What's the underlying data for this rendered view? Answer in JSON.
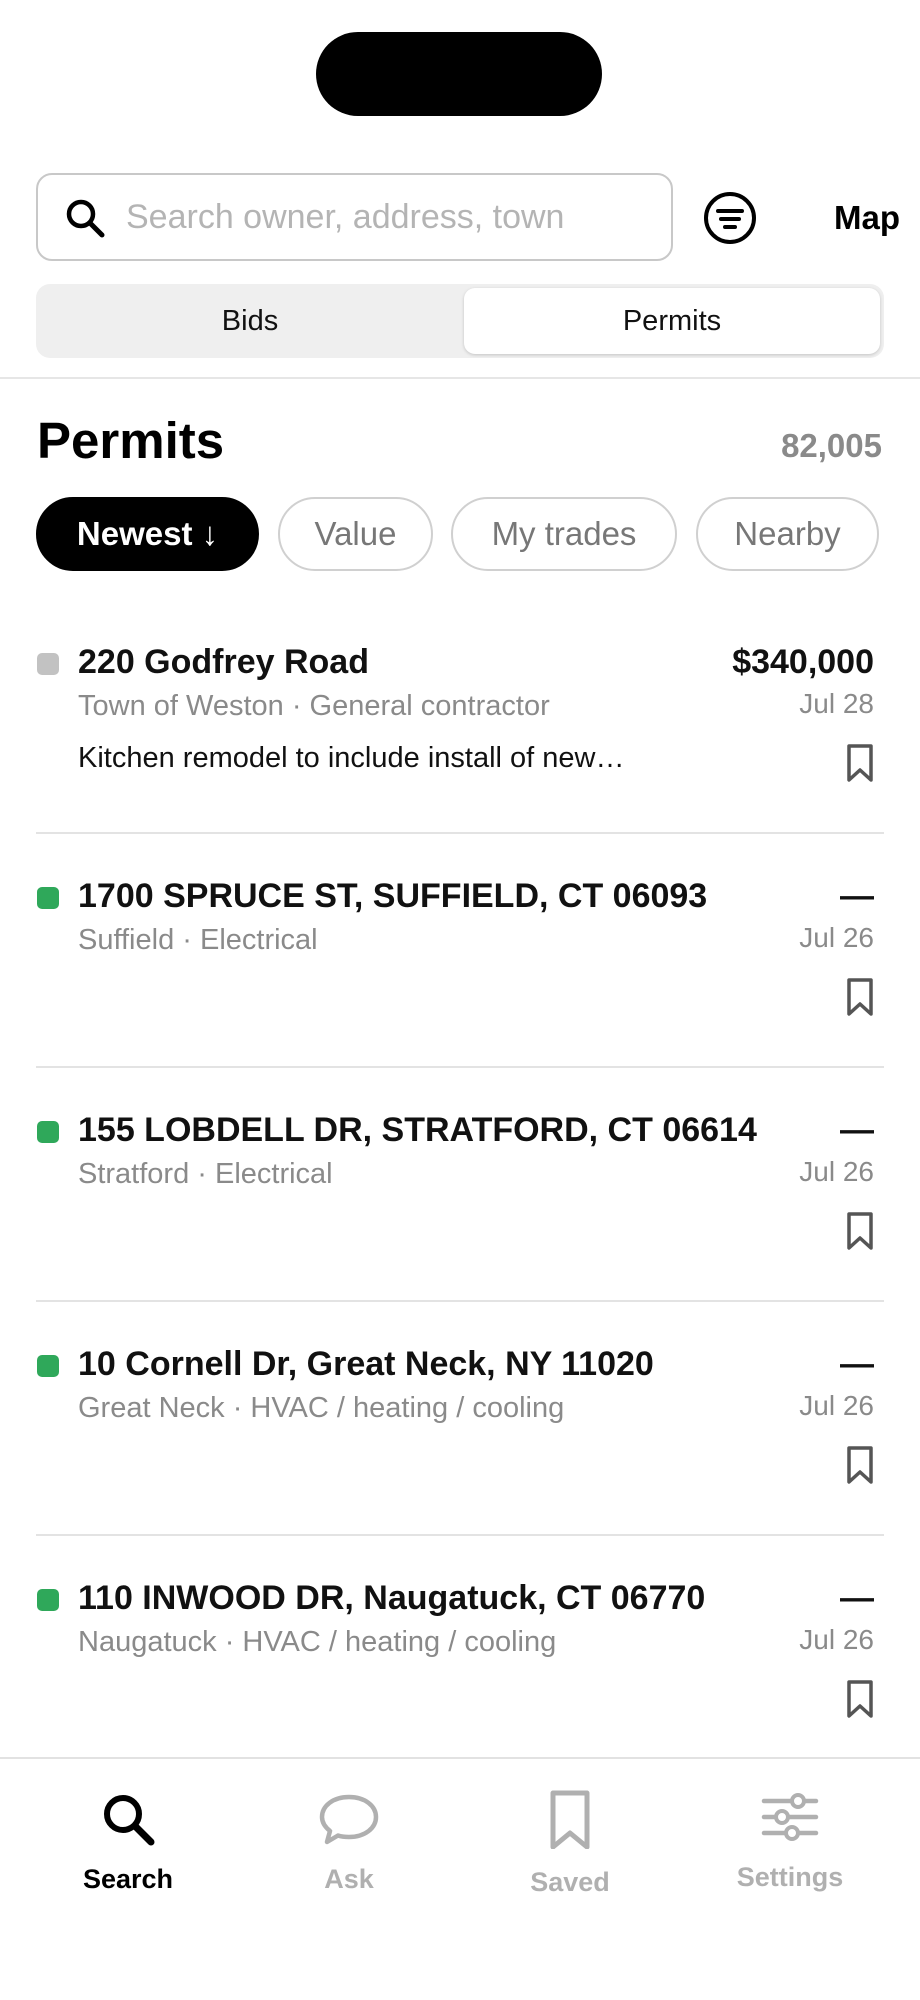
{
  "search": {
    "placeholder": "Search owner, address, town",
    "value": ""
  },
  "header": {
    "map_label": "Map"
  },
  "segments": {
    "bids_label": "Bids",
    "permits_label": "Permits",
    "selected": "Permits"
  },
  "main": {
    "title": "Permits",
    "count": "82,005"
  },
  "sort_chips": [
    {
      "label": "Newest ↓",
      "active": true
    },
    {
      "label": "Value",
      "active": false
    },
    {
      "label": "My trades",
      "active": false
    },
    {
      "label": "Nearby",
      "active": false
    }
  ],
  "permits": [
    {
      "address": "220 Godfrey Road",
      "meta": "Town of Weston · General contractor",
      "description": "Kitchen remodel to include install of new…",
      "value": "$340,000",
      "date": "Jul 28",
      "status_color": "#c2c2c2"
    },
    {
      "address": "1700 SPRUCE ST, SUFFIELD, CT 06093",
      "meta": "Suffield · Electrical",
      "description": "",
      "value": "—",
      "date": "Jul 26",
      "status_color": "#2fa85a"
    },
    {
      "address": "155 LOBDELL DR, STRATFORD, CT 06614",
      "meta": "Stratford · Electrical",
      "description": "",
      "value": "—",
      "date": "Jul 26",
      "status_color": "#2fa85a"
    },
    {
      "address": "10 Cornell Dr, Great Neck, NY 11020",
      "meta": "Great Neck · HVAC / heating / cooling",
      "description": "",
      "value": "—",
      "date": "Jul 26",
      "status_color": "#2fa85a"
    },
    {
      "address": "110 INWOOD DR, Naugatuck, CT 06770",
      "meta": "Naugatuck · HVAC / heating / cooling",
      "description": "",
      "value": "—",
      "date": "Jul 26",
      "status_color": "#2fa85a"
    }
  ],
  "tabbar": {
    "items": [
      {
        "label": "Search",
        "icon": "search-icon",
        "active": true
      },
      {
        "label": "Ask",
        "icon": "chat-bubble-icon",
        "active": false
      },
      {
        "label": "Saved",
        "icon": "bookmark-icon",
        "active": false
      },
      {
        "label": "Settings",
        "icon": "sliders-icon",
        "active": false
      }
    ]
  },
  "colors": {
    "active_green": "#2fa85a",
    "inactive_grey": "#c2c2c2",
    "muted_text": "#8a8a8a"
  }
}
